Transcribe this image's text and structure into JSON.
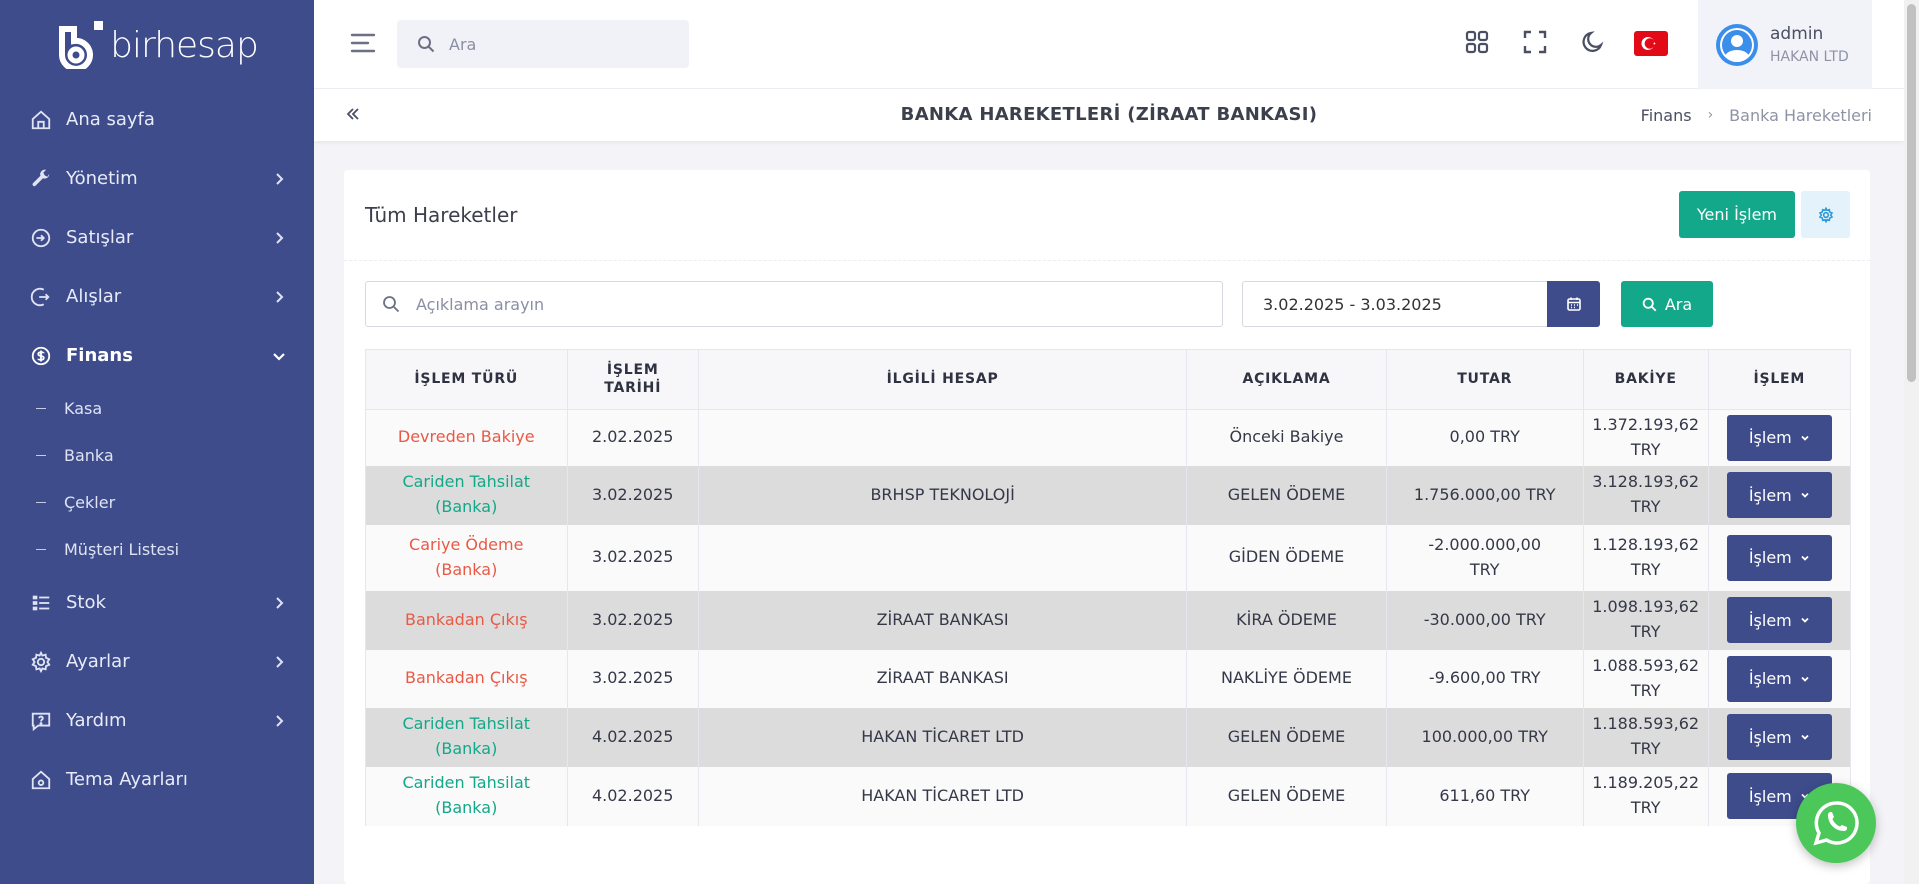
{
  "brand": {
    "name": "birhesap"
  },
  "sidebar": {
    "items": [
      {
        "label": "Ana sayfa",
        "icon": "home-icon"
      },
      {
        "label": "Yönetim",
        "icon": "wrench-icon"
      },
      {
        "label": "Satışlar",
        "icon": "sign-in-icon"
      },
      {
        "label": "Alışlar",
        "icon": "sign-out-icon"
      },
      {
        "label": "Finans",
        "icon": "dollar-circle-icon",
        "active": true
      },
      {
        "label": "Stok",
        "icon": "list-icon"
      },
      {
        "label": "Ayarlar",
        "icon": "gear-icon"
      },
      {
        "label": "Yardım",
        "icon": "help-icon"
      },
      {
        "label": "Tema Ayarları",
        "icon": "home-gear-icon"
      }
    ],
    "finans_sub": [
      {
        "label": "Kasa"
      },
      {
        "label": "Banka"
      },
      {
        "label": "Çekler"
      },
      {
        "label": "Müşteri Listesi"
      }
    ]
  },
  "topbar": {
    "search_placeholder": "Ara",
    "user": {
      "name": "admin",
      "company": "HAKAN LTD"
    }
  },
  "page": {
    "title": "BANKA HAREKETLERİ (ZİRAAT BANKASI)",
    "breadcrumb": {
      "parent": "Finans",
      "current": "Banka Hareketleri"
    }
  },
  "card": {
    "title": "Tüm Hareketler",
    "new_button": "Yeni İşlem",
    "filter": {
      "search_placeholder": "Açıklama arayın",
      "date_range": "3.02.2025 - 3.03.2025",
      "search_button": "Ara"
    }
  },
  "table": {
    "headers": {
      "type": "İŞLEM TÜRÜ",
      "date_line1": "İŞLEM",
      "date_line2": "TARİHİ",
      "account": "İLGİLİ HESAP",
      "desc": "AÇIKLAMA",
      "amount": "TUTAR",
      "balance": "BAKİYE",
      "action": "İŞLEM"
    },
    "action_label": "İşlem",
    "rows": [
      {
        "type1": "Devreden Bakiye",
        "type2": "",
        "type_color": "red",
        "date": "2.02.2025",
        "account": "",
        "desc": "Önceki Bakiye",
        "amount1": "0,00 TRY",
        "amount2": "",
        "balance1": "1.372.193,62 TRY",
        "balance2": ""
      },
      {
        "type1": "Cariden Tahsilat",
        "type2": "(Banka)",
        "type_color": "green",
        "date": "3.02.2025",
        "account": "BRHSP TEKNOLOJİ",
        "desc": "GELEN ÖDEME",
        "amount1": "1.756.000,00 TRY",
        "amount2": "",
        "balance1": "3.128.193,62 TRY",
        "balance2": ""
      },
      {
        "type1": "Cariye Ödeme",
        "type2": "(Banka)",
        "type_color": "red",
        "date": "3.02.2025",
        "account": "",
        "desc": "GİDEN ÖDEME",
        "amount1": "-2.000.000,00",
        "amount2": "TRY",
        "balance1": "1.128.193,62 TRY",
        "balance2": ""
      },
      {
        "type1": "Bankadan Çıkış",
        "type2": "",
        "type_color": "red",
        "date": "3.02.2025",
        "account": "ZİRAAT BANKASI",
        "desc": "KİRA ÖDEME",
        "amount1": "-30.000,00 TRY",
        "amount2": "",
        "balance1": "1.098.193,62",
        "balance2": "TRY"
      },
      {
        "type1": "Bankadan Çıkış",
        "type2": "",
        "type_color": "red",
        "date": "3.02.2025",
        "account": "ZİRAAT BANKASI",
        "desc": "NAKLİYE ÖDEME",
        "amount1": "-9.600,00 TRY",
        "amount2": "",
        "balance1": "1.088.593,62",
        "balance2": "TRY"
      },
      {
        "type1": "Cariden Tahsilat",
        "type2": "(Banka)",
        "type_color": "green",
        "date": "4.02.2025",
        "account": "HAKAN TİCARET LTD",
        "desc": "GELEN ÖDEME",
        "amount1": "100.000,00 TRY",
        "amount2": "",
        "balance1": "1.188.593,62",
        "balance2": "TRY"
      },
      {
        "type1": "Cariden Tahsilat",
        "type2": "(Banka)",
        "type_color": "green",
        "date": "4.02.2025",
        "account": "HAKAN TİCARET LTD",
        "desc": "GELEN ÖDEME",
        "amount1": "611,60 TRY",
        "amount2": "",
        "balance1": "1.189.205,22 TRY",
        "balance2": ""
      }
    ]
  },
  "colors": {
    "sidebar": "#3e4c8c",
    "accent_green": "#13a889",
    "danger_red": "#e85a45",
    "whatsapp": "#4cc75a"
  }
}
